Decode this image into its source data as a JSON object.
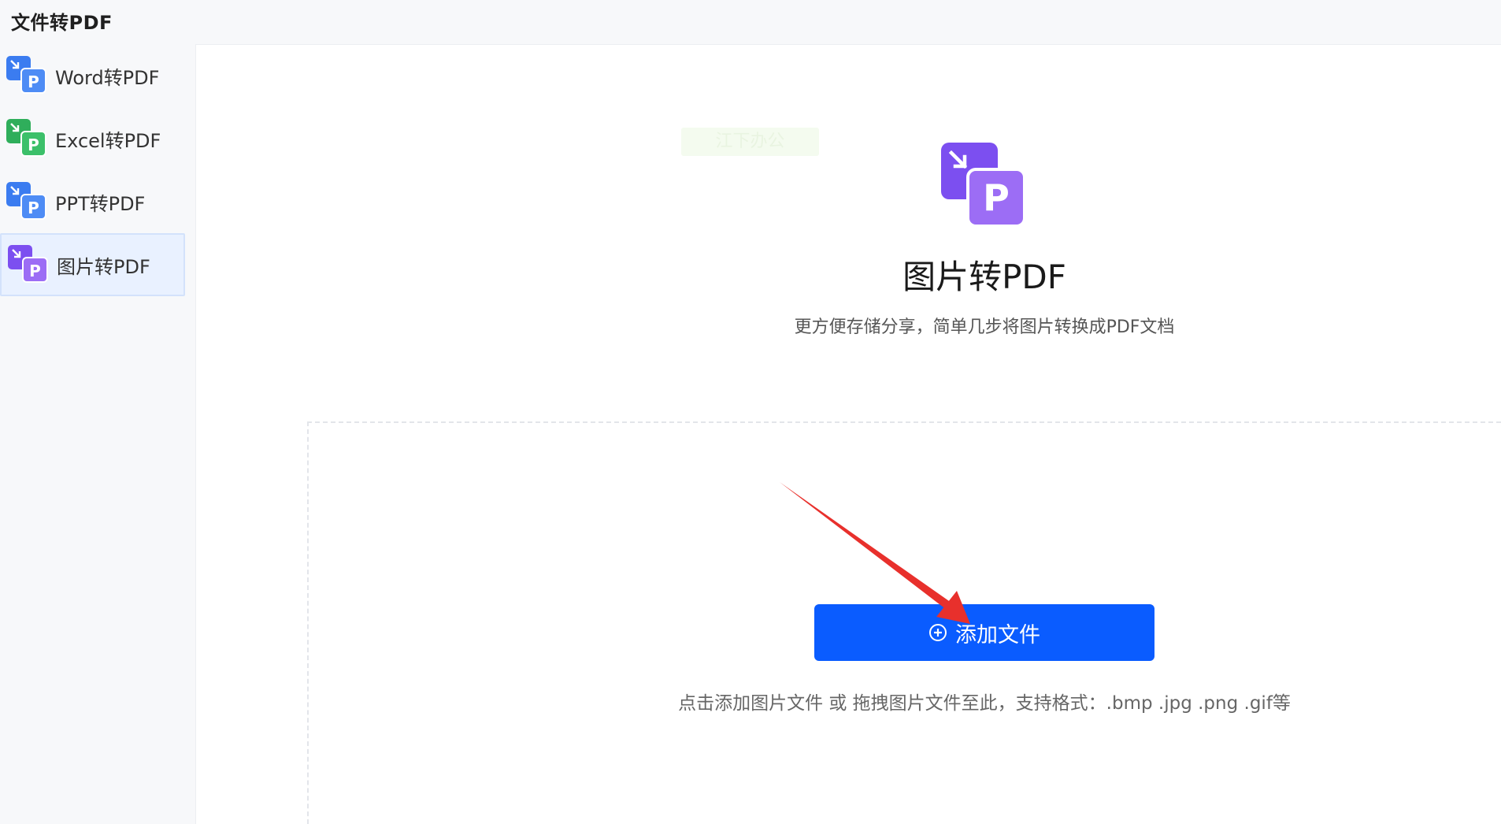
{
  "app": {
    "title": "文件转PDF"
  },
  "sidebar": {
    "items": [
      {
        "label": "Word转PDF",
        "icon": "word-to-pdf-icon",
        "color": "#3b7cf0",
        "active": false
      },
      {
        "label": "Excel转PDF",
        "icon": "excel-to-pdf-icon",
        "color": "#2fae5b",
        "active": false
      },
      {
        "label": "PPT转PDF",
        "icon": "ppt-to-pdf-icon",
        "color": "#3b7cf0",
        "active": false
      },
      {
        "label": "图片转PDF",
        "icon": "image-to-pdf-icon",
        "color": "#7c4ff0",
        "active": true
      }
    ]
  },
  "main": {
    "watermark": "江下办公",
    "hero": {
      "icon": "image-to-pdf-icon",
      "icon_letter": "P",
      "title": "图片转PDF",
      "subtitle": "更方便存储分享，简单几步将图片转换成PDF文档"
    },
    "add_button_label": "添加文件",
    "drop_hint": "点击添加图片文件 或 拖拽图片文件至此，支持格式：.bmp .jpg .png .gif等"
  },
  "colors": {
    "primary": "#0a5cff",
    "accent_purple": "#7c4ff0",
    "annotation_arrow": "#e8302c"
  }
}
